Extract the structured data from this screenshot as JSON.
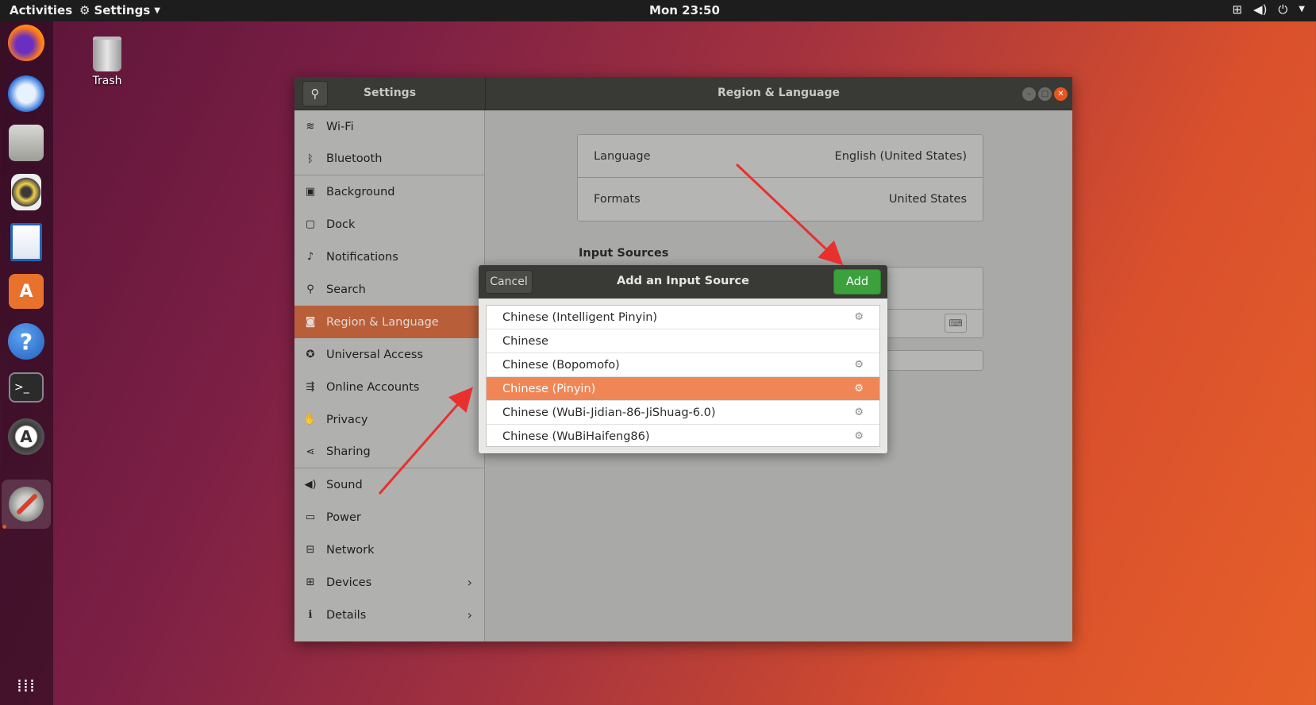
{
  "topbar": {
    "activities": "Activities",
    "app_menu": "Settings",
    "clock": "Mon 23:50"
  },
  "desktop": {
    "trash_label": "Trash"
  },
  "window": {
    "sidebar_title": "Settings",
    "main_title": "Region & Language",
    "sidebar_items": [
      {
        "label": "Wi-Fi",
        "icon": "wifi-icon",
        "glyph": "≋"
      },
      {
        "label": "Bluetooth",
        "icon": "bluetooth-icon",
        "glyph": "ᛒ"
      },
      {
        "label": "Background",
        "icon": "background-icon",
        "glyph": "▣"
      },
      {
        "label": "Dock",
        "icon": "dock-icon",
        "glyph": "▢"
      },
      {
        "label": "Notifications",
        "icon": "bell-icon",
        "glyph": "♪"
      },
      {
        "label": "Search",
        "icon": "search-icon",
        "glyph": "⚲"
      },
      {
        "label": "Region & Language",
        "icon": "region-icon",
        "glyph": "◙"
      },
      {
        "label": "Universal Access",
        "icon": "accessibility-icon",
        "glyph": "✪"
      },
      {
        "label": "Online Accounts",
        "icon": "online-accounts-icon",
        "glyph": "⇶"
      },
      {
        "label": "Privacy",
        "icon": "privacy-hand-icon",
        "glyph": "✋"
      },
      {
        "label": "Sharing",
        "icon": "share-icon",
        "glyph": "⋖"
      },
      {
        "label": "Sound",
        "icon": "sound-icon",
        "glyph": "◀)"
      },
      {
        "label": "Power",
        "icon": "power-icon",
        "glyph": "▭"
      },
      {
        "label": "Network",
        "icon": "network-icon",
        "glyph": "⊟"
      },
      {
        "label": "Devices",
        "icon": "devices-icon",
        "glyph": "⊞"
      },
      {
        "label": "Details",
        "icon": "info-icon",
        "glyph": "ℹ"
      }
    ],
    "content": {
      "language_label": "Language",
      "language_value": "English (United States)",
      "formats_label": "Formats",
      "formats_value": "United States",
      "input_sources_title": "Input Sources"
    }
  },
  "dialog": {
    "cancel_label": "Cancel",
    "title": "Add an Input Source",
    "add_label": "Add",
    "rows": [
      {
        "label": "Chinese (Intelligent Pinyin)",
        "has_settings": true
      },
      {
        "label": "Chinese",
        "has_settings": false
      },
      {
        "label": "Chinese (Bopomofo)",
        "has_settings": true
      },
      {
        "label": "Chinese (Pinyin)",
        "has_settings": true,
        "selected": true
      },
      {
        "label": "Chinese (WuBi-Jidian-86-JiShuag-6.0)",
        "has_settings": true
      },
      {
        "label": "Chinese (WuBiHaifeng86)",
        "has_settings": true
      }
    ]
  },
  "colors": {
    "accent_orange": "#e95420",
    "selection": "#f08656",
    "add_button": "#3ca03c",
    "annotation_arrow": "#e8302f"
  }
}
